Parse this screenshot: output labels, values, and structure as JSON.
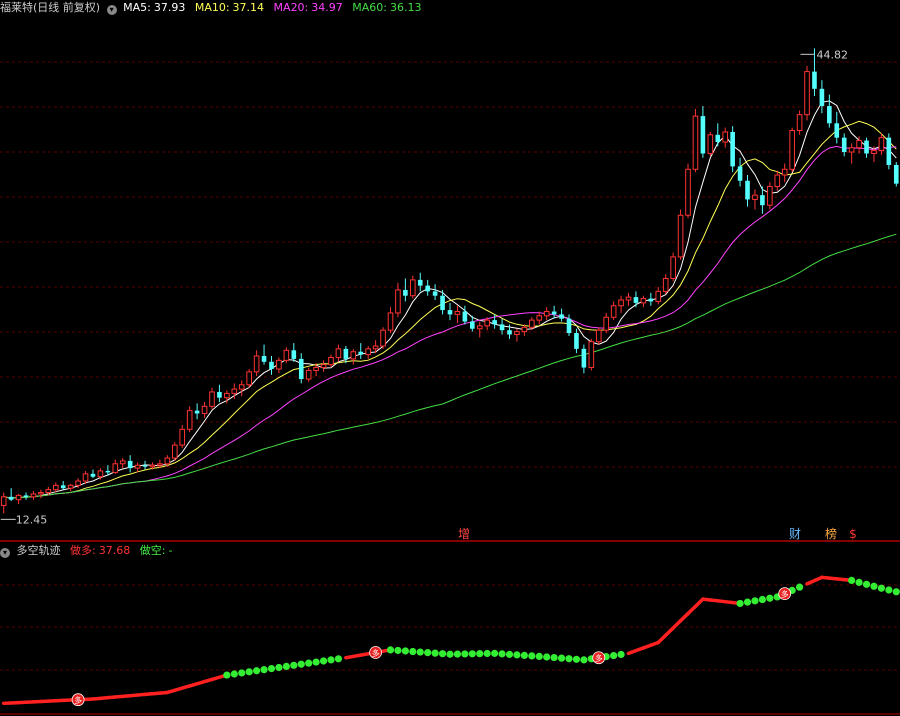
{
  "header": {
    "stock_title": "福莱特(日线 前复权)",
    "ma5": {
      "label": "MA5:",
      "value": "37.93",
      "color": "#ffffff"
    },
    "ma10": {
      "label": "MA10:",
      "value": "37.14",
      "color": "#ffff55"
    },
    "ma20": {
      "label": "MA20:",
      "value": "34.97",
      "color": "#ff44ff"
    },
    "ma60": {
      "label": "MA60:",
      "value": "36.13",
      "color": "#44dd44"
    }
  },
  "indicator": {
    "title": "多空轨迹",
    "long": {
      "label": "做多:",
      "value": "37.68",
      "color": "#ff3333"
    },
    "short": {
      "label": "做空:",
      "value": "-",
      "color": "#44ee44"
    }
  },
  "markers": [
    "增",
    "财",
    "榜",
    "$"
  ],
  "chart_data": {
    "type": "candlestick",
    "price_high_label": "44.82",
    "price_low_label": "12.45",
    "ylim": [
      11.5,
      47
    ],
    "ohlc": [
      [
        13.0,
        13.9,
        12.45,
        13.6
      ],
      [
        13.6,
        14.2,
        13.3,
        13.4
      ],
      [
        13.4,
        13.8,
        13.1,
        13.7
      ],
      [
        13.7,
        13.9,
        13.4,
        13.6
      ],
      [
        13.6,
        14.0,
        13.4,
        13.8
      ],
      [
        13.8,
        14.1,
        13.5,
        13.9
      ],
      [
        13.9,
        14.3,
        13.7,
        14.1
      ],
      [
        14.1,
        14.6,
        13.9,
        14.4
      ],
      [
        14.4,
        14.7,
        14.1,
        14.2
      ],
      [
        14.2,
        14.5,
        14.0,
        14.4
      ],
      [
        14.4,
        14.9,
        14.2,
        14.7
      ],
      [
        14.7,
        15.4,
        14.5,
        15.2
      ],
      [
        15.2,
        15.5,
        14.9,
        15.0
      ],
      [
        15.0,
        15.6,
        14.8,
        15.4
      ],
      [
        15.4,
        15.8,
        15.1,
        15.3
      ],
      [
        15.3,
        16.2,
        15.2,
        15.9
      ],
      [
        15.9,
        16.3,
        15.6,
        16.1
      ],
      [
        16.1,
        16.5,
        15.3,
        15.6
      ],
      [
        15.6,
        16.0,
        15.3,
        15.8
      ],
      [
        15.8,
        16.1,
        15.5,
        15.7
      ],
      [
        15.7,
        16.0,
        15.5,
        15.8
      ],
      [
        15.8,
        16.2,
        15.6,
        15.9
      ],
      [
        15.9,
        16.5,
        15.7,
        16.3
      ],
      [
        16.3,
        17.4,
        16.1,
        17.2
      ],
      [
        17.2,
        18.6,
        17.0,
        18.3
      ],
      [
        18.3,
        19.9,
        18.1,
        19.6
      ],
      [
        19.6,
        20.1,
        19.0,
        19.4
      ],
      [
        19.4,
        20.2,
        19.1,
        19.9
      ],
      [
        19.9,
        21.2,
        19.7,
        20.9
      ],
      [
        20.9,
        21.4,
        20.2,
        20.5
      ],
      [
        20.5,
        21.0,
        20.1,
        20.8
      ],
      [
        20.8,
        21.5,
        20.4,
        21.1
      ],
      [
        21.1,
        21.7,
        20.6,
        21.4
      ],
      [
        21.4,
        22.5,
        21.2,
        22.3
      ],
      [
        22.3,
        23.8,
        22.0,
        23.4
      ],
      [
        23.4,
        24.2,
        22.8,
        23.0
      ],
      [
        23.0,
        23.4,
        22.1,
        22.5
      ],
      [
        22.5,
        23.3,
        22.2,
        23.1
      ],
      [
        23.1,
        24.0,
        22.9,
        23.8
      ],
      [
        23.8,
        24.3,
        23.0,
        23.2
      ],
      [
        23.2,
        23.6,
        21.5,
        21.8
      ],
      [
        21.8,
        22.6,
        21.6,
        22.4
      ],
      [
        22.4,
        22.9,
        22.0,
        22.6
      ],
      [
        22.6,
        23.1,
        22.3,
        22.8
      ],
      [
        22.8,
        23.5,
        22.6,
        23.3
      ],
      [
        23.3,
        24.2,
        23.0,
        23.9
      ],
      [
        23.9,
        24.1,
        22.9,
        23.2
      ],
      [
        23.2,
        23.9,
        22.8,
        23.7
      ],
      [
        23.7,
        24.3,
        23.2,
        23.5
      ],
      [
        23.5,
        24.1,
        23.2,
        23.9
      ],
      [
        23.9,
        24.5,
        23.6,
        24.1
      ],
      [
        24.1,
        25.4,
        23.9,
        25.2
      ],
      [
        25.2,
        26.8,
        25.0,
        26.4
      ],
      [
        26.4,
        28.5,
        26.1,
        28.0
      ],
      [
        28.0,
        28.8,
        27.2,
        27.6
      ],
      [
        27.6,
        29.0,
        27.4,
        28.7
      ],
      [
        28.7,
        29.2,
        27.9,
        28.3
      ],
      [
        28.3,
        28.7,
        27.6,
        27.9
      ],
      [
        27.9,
        28.4,
        27.3,
        27.6
      ],
      [
        27.6,
        28.0,
        26.3,
        26.6
      ],
      [
        26.6,
        27.1,
        25.9,
        26.3
      ],
      [
        26.3,
        26.9,
        25.7,
        26.5
      ],
      [
        26.5,
        26.9,
        25.6,
        25.8
      ],
      [
        25.8,
        26.2,
        25.1,
        25.3
      ],
      [
        25.3,
        25.8,
        24.7,
        25.5
      ],
      [
        25.5,
        26.1,
        25.2,
        25.9
      ],
      [
        25.9,
        26.3,
        25.3,
        25.6
      ],
      [
        25.6,
        26.0,
        24.9,
        25.2
      ],
      [
        25.2,
        25.6,
        24.6,
        24.9
      ],
      [
        24.9,
        25.3,
        24.4,
        25.1
      ],
      [
        25.1,
        25.6,
        24.8,
        25.4
      ],
      [
        25.4,
        26.1,
        25.2,
        25.9
      ],
      [
        25.9,
        26.5,
        25.6,
        26.2
      ],
      [
        26.2,
        26.8,
        25.9,
        26.5
      ],
      [
        26.5,
        26.9,
        26.0,
        26.3
      ],
      [
        26.3,
        26.7,
        25.8,
        26.0
      ],
      [
        26.0,
        26.3,
        24.8,
        25.0
      ],
      [
        25.0,
        25.3,
        23.6,
        23.9
      ],
      [
        23.9,
        24.2,
        22.2,
        22.6
      ],
      [
        22.6,
        24.6,
        22.4,
        24.4
      ],
      [
        24.4,
        25.4,
        24.2,
        25.2
      ],
      [
        25.2,
        26.4,
        25.0,
        26.1
      ],
      [
        26.1,
        27.2,
        25.9,
        26.9
      ],
      [
        26.9,
        27.6,
        26.4,
        27.3
      ],
      [
        27.3,
        27.8,
        26.9,
        27.5
      ],
      [
        27.5,
        27.9,
        26.8,
        27.1
      ],
      [
        27.1,
        27.6,
        26.8,
        27.4
      ],
      [
        27.4,
        27.8,
        26.9,
        27.2
      ],
      [
        27.2,
        28.2,
        27.0,
        27.9
      ],
      [
        27.9,
        29.1,
        27.7,
        28.8
      ],
      [
        28.8,
        30.6,
        28.6,
        30.3
      ],
      [
        30.3,
        33.6,
        30.1,
        33.2
      ],
      [
        33.2,
        36.8,
        33.0,
        36.4
      ],
      [
        36.4,
        40.6,
        36.2,
        40.1
      ],
      [
        40.1,
        40.8,
        37.2,
        37.5
      ],
      [
        37.5,
        39.0,
        37.3,
        38.8
      ],
      [
        38.8,
        39.6,
        38.0,
        38.3
      ],
      [
        38.3,
        39.3,
        37.9,
        39.0
      ],
      [
        39.0,
        39.4,
        36.2,
        36.6
      ],
      [
        36.6,
        37.2,
        35.2,
        35.6
      ],
      [
        35.6,
        36.0,
        33.8,
        34.3
      ],
      [
        34.3,
        35.0,
        33.6,
        34.6
      ],
      [
        34.6,
        35.2,
        33.3,
        33.9
      ],
      [
        33.9,
        35.5,
        33.6,
        35.2
      ],
      [
        35.2,
        36.3,
        34.9,
        36.0
      ],
      [
        36.0,
        36.8,
        35.5,
        36.4
      ],
      [
        36.4,
        39.3,
        36.2,
        39.1
      ],
      [
        39.1,
        40.5,
        38.8,
        40.2
      ],
      [
        40.2,
        43.6,
        39.8,
        43.2
      ],
      [
        43.2,
        44.82,
        41.5,
        42.0
      ],
      [
        42.0,
        42.6,
        40.3,
        40.8
      ],
      [
        40.8,
        41.6,
        39.3,
        39.6
      ],
      [
        39.6,
        40.4,
        38.2,
        38.6
      ],
      [
        38.6,
        38.9,
        37.3,
        37.6
      ],
      [
        37.6,
        38.2,
        36.8,
        37.9
      ],
      [
        37.9,
        38.7,
        37.5,
        38.4
      ],
      [
        38.4,
        38.6,
        37.2,
        37.5
      ],
      [
        37.5,
        38.0,
        36.9,
        37.7
      ],
      [
        37.7,
        38.9,
        37.4,
        38.6
      ],
      [
        38.6,
        38.9,
        36.4,
        36.7
      ],
      [
        36.7,
        36.9,
        35.2,
        35.4
      ]
    ],
    "ma_periods": [
      5,
      10,
      20,
      60
    ],
    "ma_colors": [
      "#ffffff",
      "#ffff55",
      "#ff44ff",
      "#44dd44"
    ],
    "indicator_ylim": [
      10,
      45
    ],
    "indicator_points": [
      [
        0,
        12.0,
        "long"
      ],
      [
        12,
        13.0,
        "long"
      ],
      [
        22,
        14.5,
        "long"
      ],
      [
        30,
        18.5,
        "short"
      ],
      [
        40,
        21.0,
        "short"
      ],
      [
        46,
        22.5,
        "long"
      ],
      [
        52,
        24.3,
        "short"
      ],
      [
        60,
        23.3,
        "short"
      ],
      [
        66,
        23.5,
        "short"
      ],
      [
        72,
        22.8,
        "short"
      ],
      [
        78,
        22.0,
        "short"
      ],
      [
        84,
        23.5,
        "long"
      ],
      [
        88,
        26.0,
        "long"
      ],
      [
        94,
        36.0,
        "long"
      ],
      [
        99,
        35.0,
        "short"
      ],
      [
        104,
        36.5,
        "short"
      ],
      [
        108,
        39.5,
        "long"
      ],
      [
        110,
        41.0,
        "long"
      ],
      [
        114,
        40.3,
        "short"
      ],
      [
        118,
        38.5,
        "short"
      ],
      [
        120,
        37.68,
        "short"
      ]
    ],
    "indicator_badges": [
      [
        10,
        "long"
      ],
      [
        50,
        "long"
      ],
      [
        80,
        "long"
      ],
      [
        105,
        "long"
      ]
    ]
  }
}
